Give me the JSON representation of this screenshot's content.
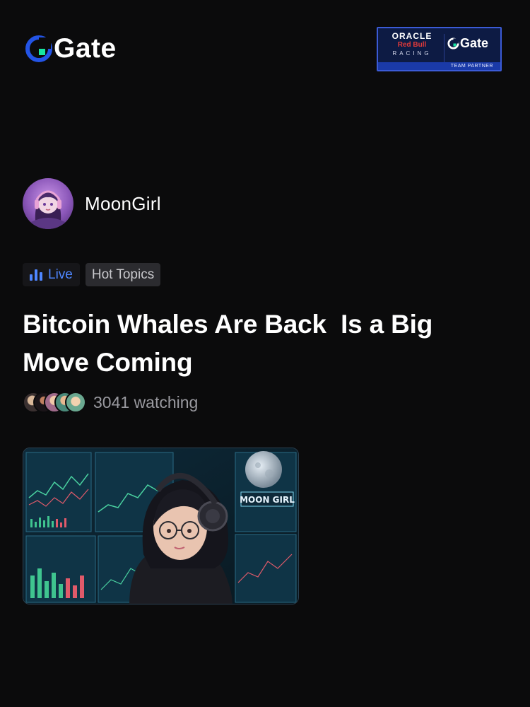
{
  "brand": {
    "name": "Gate",
    "accent": "#2354e6",
    "accent_green": "#17e6a1"
  },
  "partner_badge": {
    "oracle": "ORACLE",
    "redbull": "Red Bull",
    "racing": "RACING",
    "gate": "Gate",
    "strip": "TEAM PARTNER"
  },
  "author": {
    "name": "MoonGirl",
    "avatar_icon": "avatar-moongirl"
  },
  "tags": {
    "live": "Live",
    "topic": "Hot Topics",
    "live_color": "#4e86ff"
  },
  "post": {
    "title": "Bitcoin Whales Are Back  Is a Big\nMove Coming",
    "watching": "3041 watching"
  },
  "thumbnail": {
    "badge": "MOON GIRL"
  }
}
